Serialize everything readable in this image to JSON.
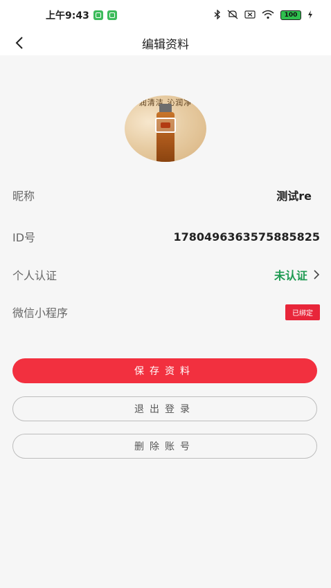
{
  "status_bar": {
    "time": "上午9:43",
    "app_icons": [
      "app-icon-1",
      "app-icon-2"
    ],
    "icons": [
      "bluetooth-icon",
      "mute-icon",
      "sim-icon",
      "wifi-icon"
    ],
    "battery": "100"
  },
  "nav": {
    "back_icon": "chevron-left-icon",
    "title": "编辑资料"
  },
  "avatar": {
    "caption": "润清洁 沁润净"
  },
  "profile": {
    "nickname_label": "昵称",
    "nickname_value": "测试re",
    "id_label": "ID号",
    "id_value": "1780496363575885825",
    "verify_label": "个人认证",
    "verify_value": "未认证",
    "verify_color": "#1e9a52",
    "wechat_label": "微信小程序",
    "wechat_badge": "已绑定",
    "badge_color": "#e8263a"
  },
  "buttons": {
    "save": "保存资料",
    "logout": "退出登录",
    "delete": "删除账号",
    "primary_color": "#f2303f"
  }
}
